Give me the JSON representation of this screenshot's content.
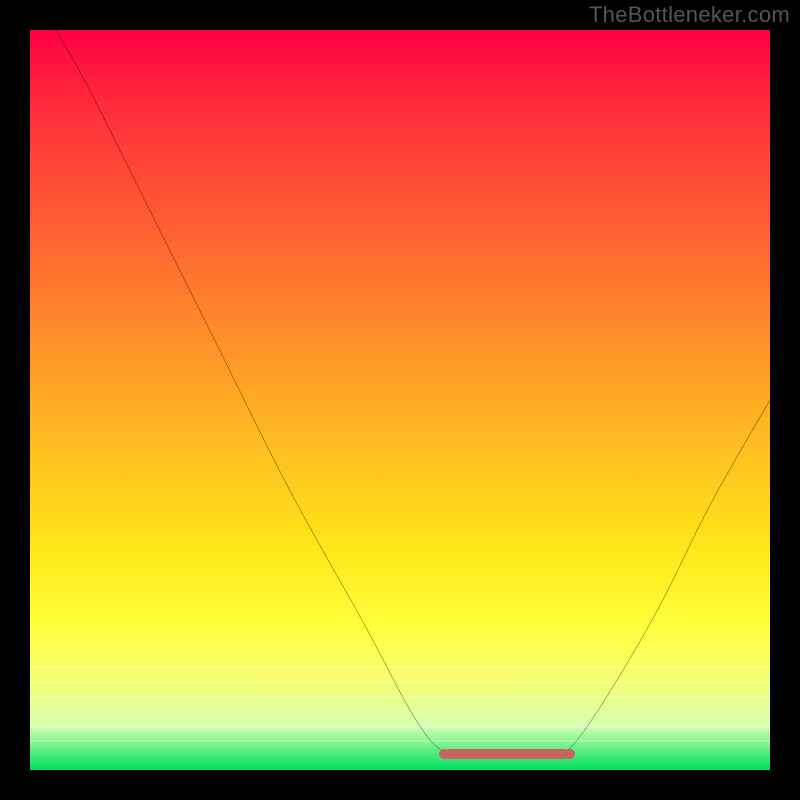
{
  "watermark": "TheBottleneker.com",
  "colors": {
    "frame": "#000000",
    "curve": "#000000",
    "marker": "#c66360"
  },
  "chart_data": {
    "type": "line",
    "title": "",
    "xlabel": "",
    "ylabel": "",
    "x_range": [
      0,
      100
    ],
    "y_range": [
      0,
      100
    ],
    "curve_points": [
      {
        "x": 3.5,
        "y": 100
      },
      {
        "x": 8,
        "y": 92
      },
      {
        "x": 15,
        "y": 78
      },
      {
        "x": 25,
        "y": 58
      },
      {
        "x": 35,
        "y": 38
      },
      {
        "x": 45,
        "y": 20
      },
      {
        "x": 52,
        "y": 7
      },
      {
        "x": 56,
        "y": 2.4
      },
      {
        "x": 60,
        "y": 2.0
      },
      {
        "x": 66,
        "y": 2.0
      },
      {
        "x": 70,
        "y": 2.2
      },
      {
        "x": 73,
        "y": 3.0
      },
      {
        "x": 78,
        "y": 10
      },
      {
        "x": 85,
        "y": 22
      },
      {
        "x": 92,
        "y": 36
      },
      {
        "x": 100,
        "y": 50
      }
    ],
    "valley_marker": {
      "x_start": 56,
      "x_end": 73,
      "y": 2.2
    },
    "background_gradient": {
      "top": "#ff0040",
      "bottom": "#00e060",
      "stops": [
        "#ff0040",
        "#ff5a33",
        "#ffba21",
        "#feff3a",
        "#00e060"
      ]
    }
  }
}
